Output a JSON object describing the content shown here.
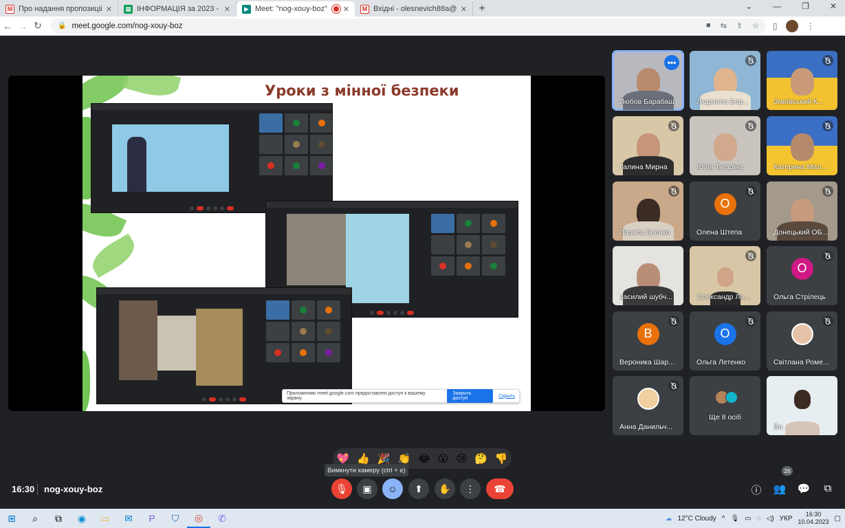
{
  "browser": {
    "tabs": [
      {
        "title": "Про надання пропозицій 10.04",
        "icon": "gmail-icon",
        "active": false
      },
      {
        "title": "ІНФОРМАЦІЯ за 2023 - Google",
        "icon": "sheets-icon",
        "active": false
      },
      {
        "title": "Meet: \"nog-xouy-boz\"",
        "icon": "meet-icon",
        "active": true
      },
      {
        "title": "Вхідні - olesnevich88a@gmail.co",
        "icon": "gmail-icon",
        "active": false
      }
    ],
    "url": "meet.google.com/nog-xouy-boz"
  },
  "presentation": {
    "slide_title": "Уроки з мінної безпеки",
    "share_notice": "Приложению meet.google.com предоставлен доступ к вашему экрану.",
    "share_stop": "Закрыть доступ",
    "share_hide": "Скрыть"
  },
  "participants": [
    {
      "name": "Любов Барабаш",
      "type": "video",
      "active": true
    },
    {
      "name": "Людмила Бер...",
      "type": "video"
    },
    {
      "name": "Змиївський К...",
      "type": "video"
    },
    {
      "name": "Галина Мирна",
      "type": "video"
    },
    {
      "name": "Юлія Тугаріна",
      "type": "video"
    },
    {
      "name": "Катерина Мал...",
      "type": "video"
    },
    {
      "name": "Лариса Боенко",
      "type": "video"
    },
    {
      "name": "Олена Штепа",
      "type": "initial",
      "initial": "О",
      "color": "#e8710a"
    },
    {
      "name": "Донецький ОБ...",
      "type": "video"
    },
    {
      "name": "василий шубч...",
      "type": "video"
    },
    {
      "name": "Олександр Ло...",
      "type": "video"
    },
    {
      "name": "Ольга Стрілець",
      "type": "initial",
      "initial": "О",
      "color": "#d01884"
    },
    {
      "name": "Вероника Шар...",
      "type": "initial",
      "initial": "В",
      "color": "#e8710a"
    },
    {
      "name": "Ольга Летенко",
      "type": "initial",
      "initial": "О",
      "color": "#1a73e8"
    },
    {
      "name": "Світлана Роме...",
      "type": "avatar"
    },
    {
      "name": "Анна Данильч...",
      "type": "avatar"
    },
    {
      "name": "Ще 8 осіб",
      "type": "more"
    },
    {
      "name": "Ви",
      "type": "video"
    }
  ],
  "reactions": [
    "💖",
    "👍",
    "🎉",
    "👏",
    "😂",
    "😮",
    "😢",
    "🤔",
    "👎"
  ],
  "tooltip": "Вимкнути камеру (ctrl + e)",
  "meeting": {
    "time": "16:30",
    "code": "nog-xouy-boz",
    "people_count": "26"
  },
  "taskbar": {
    "weather": "12°C  Cloudy",
    "lang": "УКР",
    "time": "16:30",
    "date": "10.04.2023"
  }
}
